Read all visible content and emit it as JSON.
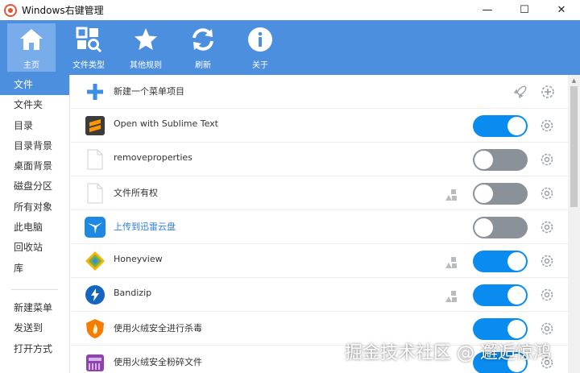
{
  "window": {
    "title": "Windows右键管理",
    "minimize": "—",
    "maximize": "☐",
    "close": "✕"
  },
  "toolbar": {
    "items": [
      {
        "label": "主页",
        "icon": "home-icon",
        "active": true
      },
      {
        "label": "文件类型",
        "icon": "file-type-icon",
        "active": false
      },
      {
        "label": "其他规则",
        "icon": "star-icon",
        "active": false
      },
      {
        "label": "刷新",
        "icon": "refresh-icon",
        "active": false
      },
      {
        "label": "关于",
        "icon": "info-icon",
        "active": false
      }
    ],
    "color": "#4c8fdf"
  },
  "sidebar": {
    "items": [
      "文件",
      "文件夹",
      "目录",
      "目录背景",
      "桌面背景",
      "磁盘分区",
      "所有对象",
      "此电脑",
      "回收站",
      "库"
    ],
    "items2": [
      "新建菜单",
      "发送到",
      "打开方式"
    ],
    "active_index": 0
  },
  "list": {
    "new_item_label": "新建一个菜单项目",
    "rows": [
      {
        "label": "Open with Sublime Text",
        "icon": "sublime-icon",
        "enabled": true,
        "perm": false,
        "link": false
      },
      {
        "label": "removeproperties",
        "icon": "blank-file-icon",
        "enabled": false,
        "perm": false,
        "link": false
      },
      {
        "label": "文件所有权",
        "icon": "blank-file-icon",
        "enabled": false,
        "perm": true,
        "link": false
      },
      {
        "label": "上传到迅雷云盘",
        "icon": "thunder-cloud-icon",
        "enabled": false,
        "perm": false,
        "link": true
      },
      {
        "label": "Honeyview",
        "icon": "honeyview-icon",
        "enabled": true,
        "perm": true,
        "link": false
      },
      {
        "label": "Bandizip",
        "icon": "bandizip-icon",
        "enabled": true,
        "perm": true,
        "link": false
      },
      {
        "label": "使用火绒安全进行杀毒",
        "icon": "huorong-icon",
        "enabled": true,
        "perm": false,
        "link": false
      },
      {
        "label": "使用火绒安全粉碎文件",
        "icon": "huorong-shred-icon",
        "enabled": true,
        "perm": false,
        "link": false
      }
    ]
  },
  "watermark": "掘金技术社区 @ 邂逅惊鸿"
}
